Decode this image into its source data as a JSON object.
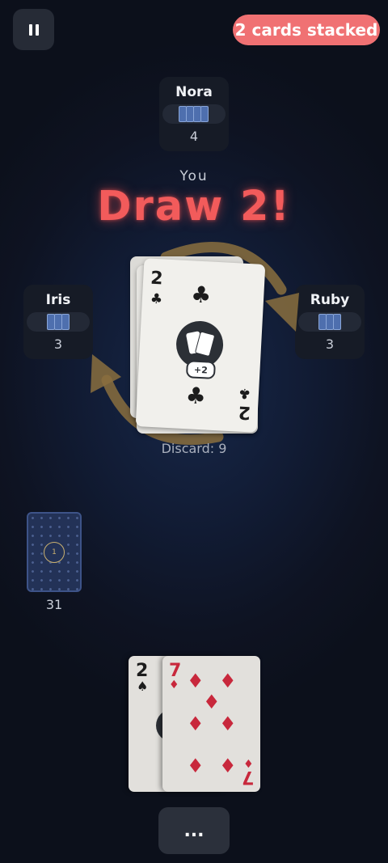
{
  "pause_button": {
    "icon": "pause-icon"
  },
  "stack_badge": {
    "text": "2 cards stacked",
    "color": "#f07173"
  },
  "opponents": {
    "top": {
      "name": "Nora",
      "count": "4"
    },
    "left": {
      "name": "Iris",
      "count": "3"
    },
    "right": {
      "name": "Ruby",
      "count": "3"
    }
  },
  "turn_label": "You",
  "action_text": "Draw 2!",
  "discard": {
    "label": "Discard: 9",
    "top_card": {
      "rank": "2",
      "suit": "♣",
      "badge": "+2"
    }
  },
  "draw_pile": {
    "count": "31",
    "center_label": "1"
  },
  "hand": [
    {
      "rank": "2",
      "suit": "♠"
    },
    {
      "rank": "7",
      "suit": "♦"
    }
  ],
  "more_button": {
    "label": "..."
  },
  "colors": {
    "accent_red": "#f25b5b",
    "direction_arrow": "#8a6f3e",
    "card_back": "#233257"
  }
}
